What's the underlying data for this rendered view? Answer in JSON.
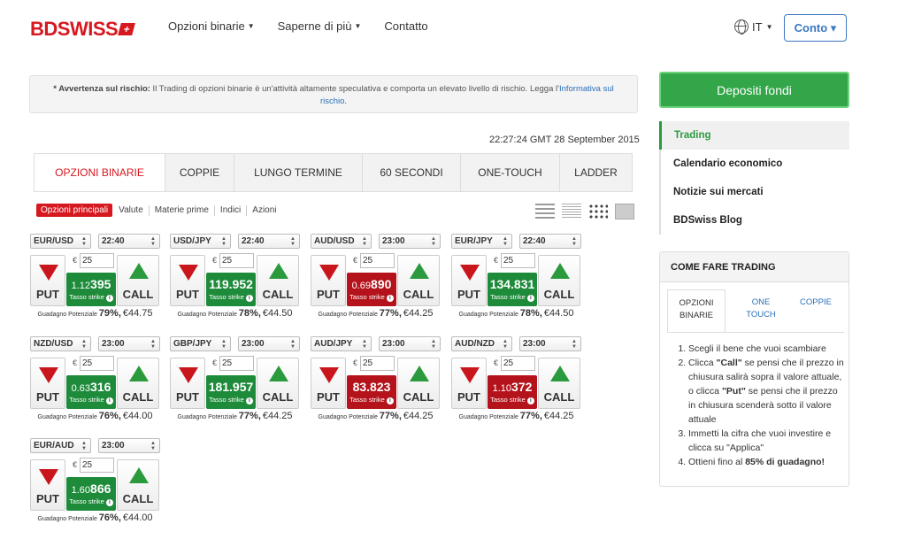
{
  "header": {
    "logo_bd": "BD",
    "logo_swiss": "SWISS",
    "nav": [
      {
        "label": "Opzioni binarie",
        "caret": true
      },
      {
        "label": "Saperne di più",
        "caret": true
      },
      {
        "label": "Contatto",
        "caret": false
      }
    ],
    "lang": "IT",
    "account_button": "Conto ▾"
  },
  "warning": {
    "bold": "* Avvertenza sul rischio:",
    "text": " Il Trading di opzioni binarie è un'attività  altamente speculativa e comporta un elevato livello di rischio. Legga l'",
    "link": "Informativa sul rischio",
    "end": "."
  },
  "clock": "22:27:24 GMT 28 September 2015",
  "tabs": [
    "OPZIONI BINARIE",
    "COPPIE",
    "LUNGO TERMINE",
    "60 SECONDI",
    "ONE-TOUCH",
    "LADDER"
  ],
  "subtabs": [
    "Opzioni principali",
    "Valute",
    "Materie prime",
    "Indici",
    "Azioni"
  ],
  "labels": {
    "put": "PUT",
    "call": "CALL",
    "tasso": "Tasso strike",
    "gain": "Guadagno Potenziale",
    "euro": "€",
    "info": "i"
  },
  "cards": [
    {
      "asset": "EUR/USD",
      "time": "22:40",
      "amount": "25",
      "rate_pre": "1.12",
      "rate_big": "395",
      "color": "green",
      "pct": "79%,",
      "payout": "€44.75"
    },
    {
      "asset": "USD/JPY",
      "time": "22:40",
      "amount": "25",
      "rate_pre": "",
      "rate_big": "119.952",
      "color": "green",
      "pct": "78%,",
      "payout": "€44.50"
    },
    {
      "asset": "AUD/USD",
      "time": "23:00",
      "amount": "25",
      "rate_pre": "0.69",
      "rate_big": "890",
      "color": "red",
      "pct": "77%,",
      "payout": "€44.25"
    },
    {
      "asset": "EUR/JPY",
      "time": "22:40",
      "amount": "25",
      "rate_pre": "",
      "rate_big": "134.831",
      "color": "green",
      "pct": "78%,",
      "payout": "€44.50"
    },
    {
      "asset": "NZD/USD",
      "time": "23:00",
      "amount": "25",
      "rate_pre": "0.63",
      "rate_big": "316",
      "color": "green",
      "pct": "76%,",
      "payout": "€44.00"
    },
    {
      "asset": "GBP/JPY",
      "time": "23:00",
      "amount": "25",
      "rate_pre": "",
      "rate_big": "181.957",
      "color": "green",
      "pct": "77%,",
      "payout": "€44.25"
    },
    {
      "asset": "AUD/JPY",
      "time": "23:00",
      "amount": "25",
      "rate_pre": "",
      "rate_big": "83.823",
      "color": "red",
      "pct": "77%,",
      "payout": "€44.25"
    },
    {
      "asset": "AUD/NZD",
      "time": "23:00",
      "amount": "25",
      "rate_pre": "1.10",
      "rate_big": "372",
      "color": "red",
      "pct": "77%,",
      "payout": "€44.25"
    },
    {
      "asset": "EUR/AUD",
      "time": "23:00",
      "amount": "25",
      "rate_pre": "1.60",
      "rate_big": "866",
      "color": "green",
      "pct": "76%,",
      "payout": "€44.00"
    }
  ],
  "sidebar": {
    "deposit_button": "Depositi fondi",
    "items": [
      "Trading",
      "Calendario economico",
      "Notizie sui mercati",
      "BDSwiss Blog"
    ],
    "howto_title": "COME FARE TRADING",
    "howto_tabs": [
      "OPZIONI BINARIE",
      "ONE TOUCH",
      "COPPIE"
    ],
    "steps": [
      {
        "pre": "Scegli il bene che vuoi scambiare",
        "b1": "",
        "mid": "",
        "b2": "",
        "post": ""
      },
      {
        "pre": "Clicca ",
        "b1": "\"Call\"",
        "mid": " se pensi che il prezzo in chiusura salirà sopra il valore attuale, o clicca ",
        "b2": "\"Put\"",
        "post": " se pensi che il prezzo in chiusura scenderà sotto il valore attuale"
      },
      {
        "pre": "Immetti la cifra che vuoi investire e clicca su \"Applica\"",
        "b1": "",
        "mid": "",
        "b2": "",
        "post": ""
      },
      {
        "pre": "Ottieni fino al ",
        "b1": "85% di guadagno!",
        "mid": "",
        "b2": "",
        "post": ""
      }
    ]
  },
  "colors": {
    "brand_red": "#d6181f",
    "green": "#1e8b3a",
    "red": "#b4131b",
    "link": "#2a6fb8"
  }
}
